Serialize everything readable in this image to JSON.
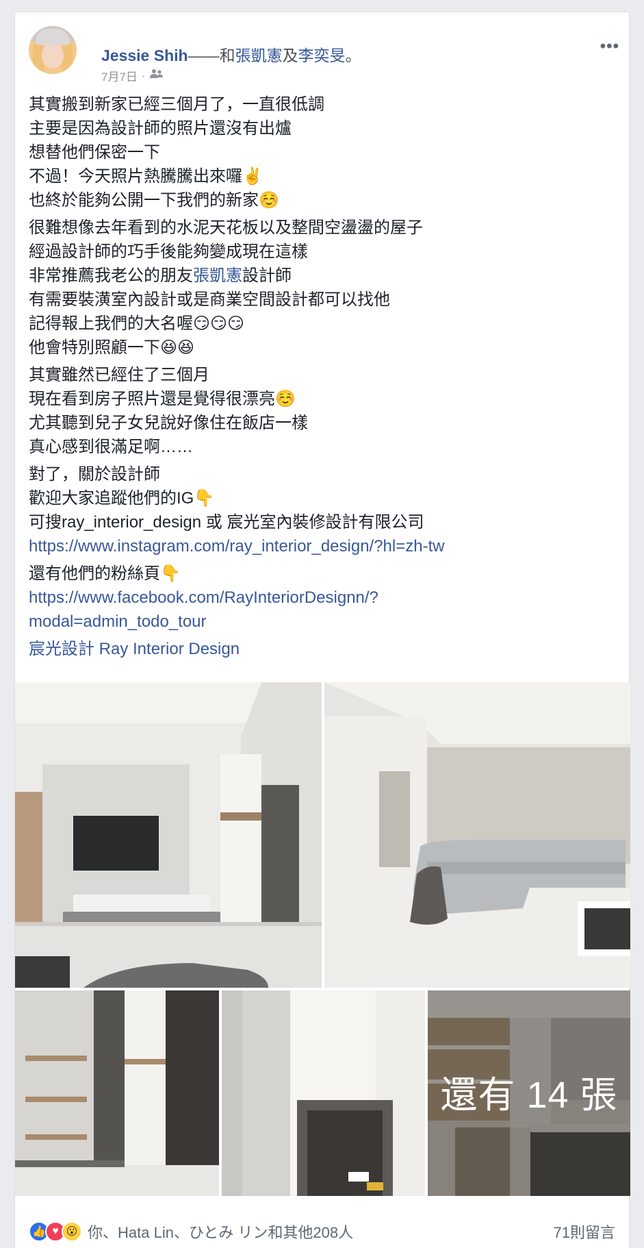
{
  "header": {
    "author": "Jessie Shih",
    "with_prefix": "——和",
    "tagged_1": "張凱憲",
    "and_word": "及",
    "tagged_2": "李奕旻",
    "suffix": "。",
    "date": "7月7日",
    "dot": "·",
    "audience_icon": "friends-icon",
    "more_icon": "more-options-icon"
  },
  "post": {
    "para1": [
      "其實搬到新家已經三個月了，一直很低調",
      "主要是因為設計師的照片還沒有出爐",
      "想替他們保密一下",
      "不過！今天照片熱騰騰出來囉✌️",
      "也終於能夠公開一下我們的新家☺️"
    ],
    "para2_lines": [
      "很難想像去年看到的水泥天花板以及整間空盪盪的屋子",
      "經過設計師的巧手後能夠變成現在這樣"
    ],
    "para2_line3_prefix": "非常推薦我老公的朋友",
    "para2_line3_link": "張凱憲",
    "para2_line3_suffix": "設計師",
    "para2_rest": [
      "有需要裝潢室內設計或是商業空間設計都可以找他",
      "記得報上我們的大名喔😏😏😏",
      "他會特別照顧一下😆😆"
    ],
    "para3": [
      "其實雖然已經住了三個月",
      "現在看到房子照片還是覺得很漂亮☺️",
      "尤其聽到兒子女兒說好像住在飯店一樣",
      "真心感到很滿足啊……"
    ],
    "para4": [
      "對了，關於設計師",
      "歡迎大家追蹤他們的IG👇",
      "可搜ray_interior_design 或 宸光室內裝修設計有限公司"
    ],
    "ig_link": "https://www.instagram.com/ray_interior_design/?hl=zh-tw",
    "para5": "還有他們的粉絲頁👇",
    "fb_link_1": "https://www.facebook.com/RayInteriorDesignn/?",
    "fb_link_2": "modal=admin_todo_tour",
    "page_link": "宸光設計 Ray Interior Design"
  },
  "photos": {
    "more_overlay": "還有 14 張"
  },
  "footer": {
    "reaction_icons": [
      "like-icon",
      "love-icon",
      "wow-icon"
    ],
    "reactions_text": "你、Hata Lin、ひとみ リン和其他208人",
    "comments": "71則留言"
  }
}
